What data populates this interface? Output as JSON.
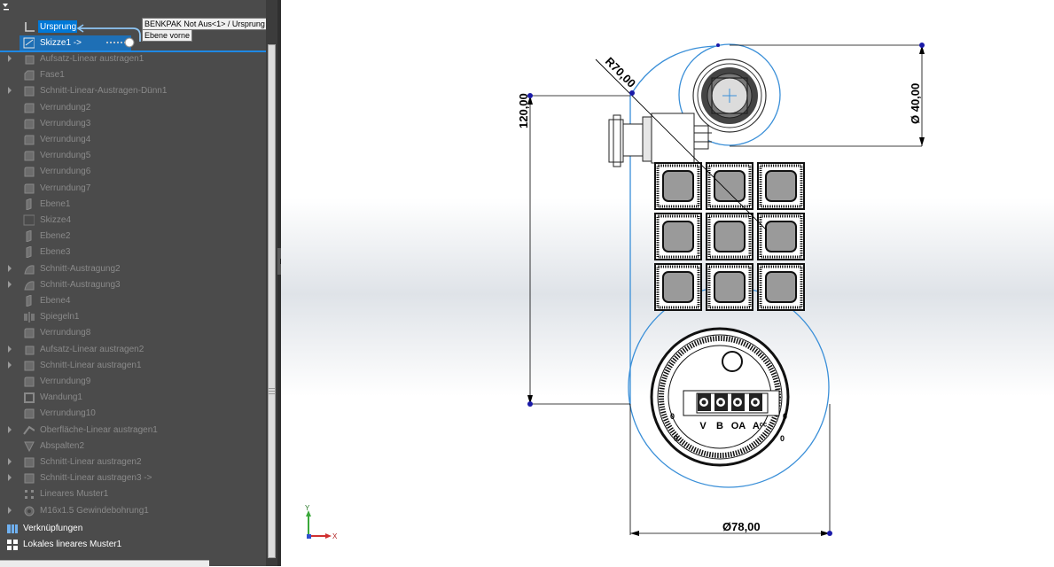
{
  "tree": {
    "header_item": "Ursprung",
    "sketch_item": "Skizze1 ->",
    "tooltip_main": "BENKPAK Not Aus<1> / Ursprung",
    "tooltip_plane": "Ebene vorne",
    "items": [
      {
        "label": "Aufsatz-Linear austragen1",
        "expand": true,
        "icon": "extrude-icon"
      },
      {
        "label": "Fase1",
        "expand": false,
        "icon": "chamfer-icon"
      },
      {
        "label": "Schnitt-Linear-Austragen-Dünn1",
        "expand": true,
        "icon": "cut-extrude-icon"
      },
      {
        "label": "Verrundung2",
        "expand": false,
        "icon": "fillet-icon"
      },
      {
        "label": "Verrundung3",
        "expand": false,
        "icon": "fillet-icon"
      },
      {
        "label": "Verrundung4",
        "expand": false,
        "icon": "fillet-icon"
      },
      {
        "label": "Verrundung5",
        "expand": false,
        "icon": "fillet-icon"
      },
      {
        "label": "Verrundung6",
        "expand": false,
        "icon": "fillet-icon"
      },
      {
        "label": "Verrundung7",
        "expand": false,
        "icon": "fillet-icon"
      },
      {
        "label": "Ebene1",
        "expand": false,
        "icon": "plane-icon"
      },
      {
        "label": "Skizze4",
        "expand": false,
        "icon": "sketch-icon"
      },
      {
        "label": "Ebene2",
        "expand": false,
        "icon": "plane-icon"
      },
      {
        "label": "Ebene3",
        "expand": false,
        "icon": "plane-icon"
      },
      {
        "label": "Schnitt-Austragung2",
        "expand": true,
        "icon": "cut-sweep-icon"
      },
      {
        "label": "Schnitt-Austragung3",
        "expand": true,
        "icon": "cut-sweep-icon"
      },
      {
        "label": "Ebene4",
        "expand": false,
        "icon": "plane-icon"
      },
      {
        "label": "Spiegeln1",
        "expand": false,
        "icon": "mirror-icon"
      },
      {
        "label": "Verrundung8",
        "expand": false,
        "icon": "fillet-icon"
      },
      {
        "label": "Aufsatz-Linear austragen2",
        "expand": true,
        "icon": "extrude-icon"
      },
      {
        "label": "Schnitt-Linear austragen1",
        "expand": true,
        "icon": "cut-extrude-icon"
      },
      {
        "label": "Verrundung9",
        "expand": false,
        "icon": "fillet-icon"
      },
      {
        "label": "Wandung1",
        "expand": false,
        "icon": "shell-icon"
      },
      {
        "label": "Verrundung10",
        "expand": false,
        "icon": "fillet-icon"
      },
      {
        "label": "Oberfläche-Linear austragen1",
        "expand": true,
        "icon": "surface-extrude-icon"
      },
      {
        "label": "Abspalten2",
        "expand": false,
        "icon": "split-icon"
      },
      {
        "label": "Schnitt-Linear austragen2",
        "expand": true,
        "icon": "cut-extrude-icon"
      },
      {
        "label": "Schnitt-Linear austragen3 ->",
        "expand": true,
        "icon": "cut-extrude-icon"
      },
      {
        "label": "Lineares Muster1",
        "expand": false,
        "icon": "linear-pattern-icon"
      },
      {
        "label": "M16x1.5 Gewindebohrung1",
        "expand": true,
        "icon": "hole-wizard-icon"
      }
    ],
    "bottom_items": [
      {
        "label": "Verknüpfungen",
        "icon": "mates-icon"
      },
      {
        "label": "Lokales lineares Muster1",
        "icon": "local-pattern-icon"
      }
    ]
  },
  "sketch": {
    "radius_dim": "R70,00",
    "height_dim": "120,00",
    "dia_small": "Ø 40,00",
    "dia_large": "Ø78,00",
    "dial_labels": [
      "V",
      "B",
      "OA",
      "Aᶜᶜ"
    ],
    "dial_numbers": [
      "0",
      "0",
      "0",
      "0"
    ]
  },
  "triad": {
    "x_label": "X",
    "y_label": "Y"
  },
  "colors": {
    "sketch_blue": "#3a8fd8",
    "selection": "#0078d7",
    "tree_bg": "#4b4b4b",
    "dimension": "#000000",
    "point": "#1a1aa8"
  }
}
